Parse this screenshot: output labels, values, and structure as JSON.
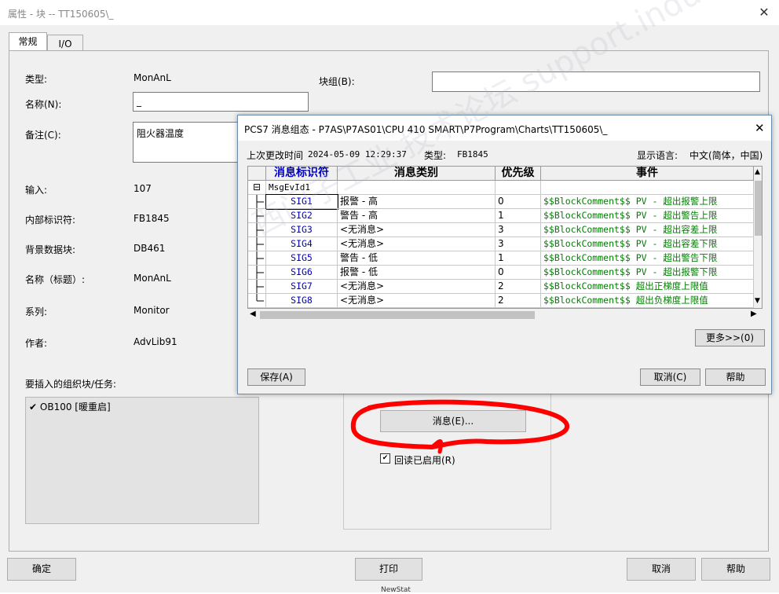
{
  "window": {
    "title": "属性 - 块 -- TT150605\\_",
    "close": "✕"
  },
  "tabs": [
    "常规",
    "I/O"
  ],
  "general": {
    "type_label": "类型:",
    "type_value": "MonAnL",
    "name_label": "名称(N):",
    "name_value": "_",
    "comment_label": "备注(C):",
    "comment_value": "阻火器温度",
    "input_label": "输入:",
    "input_value": "107",
    "internal_id_label": "内部标识符:",
    "internal_id_value": "FB1845",
    "instance_db_label": "背景数据块:",
    "instance_db_value": "DB461",
    "name_header_label": "名称（标题）:",
    "name_header_value": "MonAnL",
    "family_label": "系列:",
    "family_value": "Monitor",
    "author_label": "作者:",
    "author_value": "AdvLib91",
    "block_group_label": "块组(B):",
    "block_group_value": "",
    "insert_ob_label": "要插入的组织块/任务:",
    "ob_items": [
      {
        "check": "✔",
        "label": "OB100 [暖重启]"
      }
    ],
    "message_button": "消息(E)...",
    "readback_checkbox": "☑",
    "readback_label": "回读已启用(R)"
  },
  "footer": {
    "ok": "确定",
    "print": "打印",
    "cancel": "取消",
    "help": "帮助"
  },
  "message_dialog": {
    "title": "PCS7 消息组态 - P7AS\\P7AS01\\CPU 410 SMART\\P7Program\\Charts\\TT150605\\_",
    "close": "✕",
    "last_changed_label": "上次更改时间",
    "last_changed_value": "2024-05-09 12:29:37",
    "type_label": "类型:",
    "type_value": "FB1845",
    "display_lang_label": "显示语言:",
    "display_lang_value": "中文(简体，中国)",
    "columns": [
      "消息标识符",
      "消息类别",
      "优先级",
      "事件"
    ],
    "group": {
      "expander": "⊟",
      "name": "MsgEvId1"
    },
    "rows": [
      {
        "id": "SIG1",
        "category": "报警 - 高",
        "priority": "0",
        "event": "$$BlockComment$$ PV - 超出报警上限"
      },
      {
        "id": "SIG2",
        "category": "警告 - 高",
        "priority": "1",
        "event": "$$BlockComment$$ PV - 超出警告上限"
      },
      {
        "id": "SIG3",
        "category": "<无消息>",
        "priority": "3",
        "event": "$$BlockComment$$ PV - 超出容差上限"
      },
      {
        "id": "SIG4",
        "category": "<无消息>",
        "priority": "3",
        "event": "$$BlockComment$$ PV - 超出容差下限"
      },
      {
        "id": "SIG5",
        "category": "警告 - 低",
        "priority": "1",
        "event": "$$BlockComment$$ PV - 超出警告下限"
      },
      {
        "id": "SIG6",
        "category": "报警 - 低",
        "priority": "0",
        "event": "$$BlockComment$$ PV - 超出报警下限"
      },
      {
        "id": "SIG7",
        "category": "<无消息>",
        "priority": "2",
        "event": "$$BlockComment$$ 超出正梯度上限值"
      },
      {
        "id": "SIG8",
        "category": "<无消息>",
        "priority": "2",
        "event": "$$BlockComment$$ 超出负梯度上限值"
      }
    ],
    "more_button": "更多>>(0)",
    "save_button": "保存(A)",
    "cancel_button": "取消(C)",
    "help_button": "帮助"
  },
  "watermark": "西门子工业 技术论坛 support.industry.siemens.com/cs",
  "bottom_strip": "NewStat",
  "colors": {
    "annotation_red": "#ff0000",
    "event_green": "#008000",
    "id_blue": "#0000c0",
    "header_blue": "#0000c0"
  }
}
